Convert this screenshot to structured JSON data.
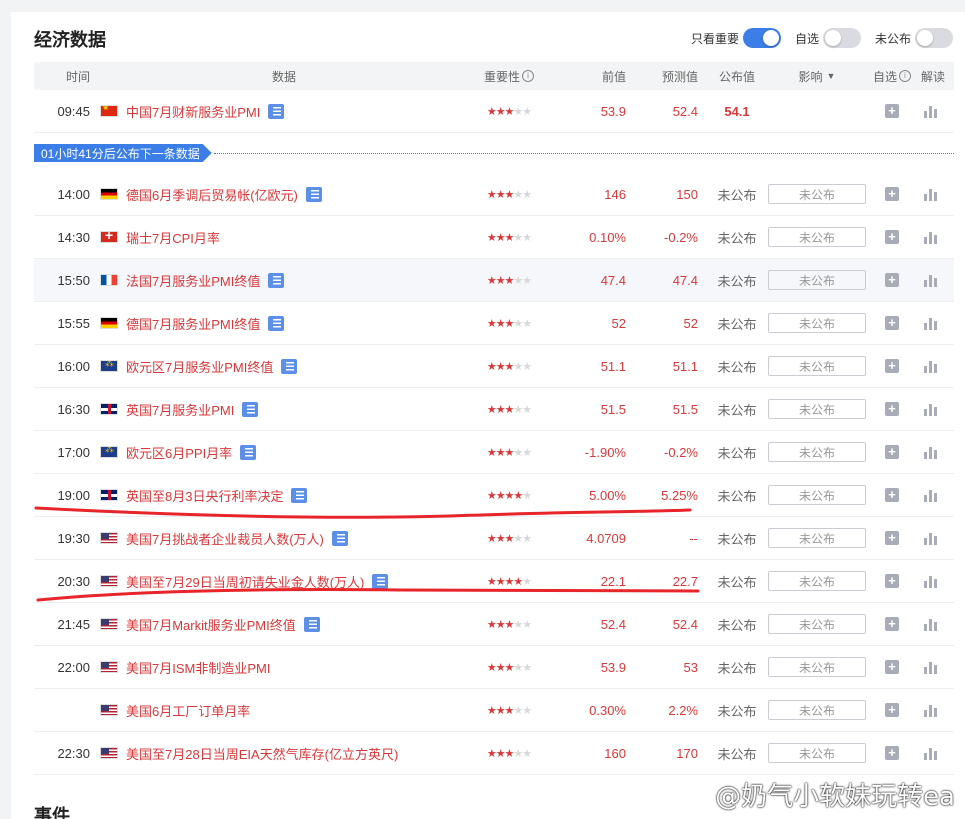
{
  "header": {
    "title": "经济数据",
    "toggles": [
      {
        "label": "只看重要",
        "on": true
      },
      {
        "label": "自选",
        "on": false
      },
      {
        "label": "未公布",
        "on": false
      }
    ]
  },
  "table": {
    "columns": {
      "time": "时间",
      "data": "数据",
      "importance": "重要性",
      "previous": "前值",
      "forecast": "预测值",
      "actual": "公布值",
      "impact": "影响",
      "watch": "自选",
      "analysis": "解读"
    },
    "rows": [
      {
        "time": "09:45",
        "flag": "cn",
        "name": "中国7月财新服务业PMI",
        "doc": true,
        "stars": 3,
        "prev": "53.9",
        "fore": "52.4",
        "actual": "54.1",
        "impact": "",
        "hl": false
      },
      {
        "time": "14:00",
        "flag": "de",
        "name": "德国6月季调后贸易帐(亿欧元)",
        "doc": true,
        "stars": 3,
        "prev": "146",
        "fore": "150",
        "actual": "未公布",
        "impact": "未公布",
        "hl": false
      },
      {
        "time": "14:30",
        "flag": "ch",
        "name": "瑞士7月CPI月率",
        "doc": false,
        "stars": 3,
        "prev": "0.10%",
        "fore": "-0.2%",
        "actual": "未公布",
        "impact": "未公布",
        "hl": false
      },
      {
        "time": "15:50",
        "flag": "fr",
        "name": "法国7月服务业PMI终值",
        "doc": true,
        "stars": 3,
        "prev": "47.4",
        "fore": "47.4",
        "actual": "未公布",
        "impact": "未公布",
        "hl": true
      },
      {
        "time": "15:55",
        "flag": "de",
        "name": "德国7月服务业PMI终值",
        "doc": true,
        "stars": 3,
        "prev": "52",
        "fore": "52",
        "actual": "未公布",
        "impact": "未公布",
        "hl": false
      },
      {
        "time": "16:00",
        "flag": "eu",
        "name": "欧元区7月服务业PMI终值",
        "doc": true,
        "stars": 3,
        "prev": "51.1",
        "fore": "51.1",
        "actual": "未公布",
        "impact": "未公布",
        "hl": false
      },
      {
        "time": "16:30",
        "flag": "gb",
        "name": "英国7月服务业PMI",
        "doc": true,
        "stars": 3,
        "prev": "51.5",
        "fore": "51.5",
        "actual": "未公布",
        "impact": "未公布",
        "hl": false
      },
      {
        "time": "17:00",
        "flag": "eu",
        "name": "欧元区6月PPI月率",
        "doc": true,
        "stars": 3,
        "prev": "-1.90%",
        "fore": "-0.2%",
        "actual": "未公布",
        "impact": "未公布",
        "hl": false
      },
      {
        "time": "19:00",
        "flag": "gb",
        "name": "英国至8月3日央行利率决定",
        "doc": true,
        "stars": 4,
        "prev": "5.00%",
        "fore": "5.25%",
        "actual": "未公布",
        "impact": "未公布",
        "hl": false
      },
      {
        "time": "19:30",
        "flag": "us",
        "name": "美国7月挑战者企业裁员人数(万人)",
        "doc": true,
        "stars": 3,
        "prev": "4.0709",
        "fore": "--",
        "actual": "未公布",
        "impact": "未公布",
        "hl": false
      },
      {
        "time": "20:30",
        "flag": "us",
        "name": "美国至7月29日当周初请失业金人数(万人)",
        "doc": true,
        "stars": 4,
        "prev": "22.1",
        "fore": "22.7",
        "actual": "未公布",
        "impact": "未公布",
        "hl": false
      },
      {
        "time": "21:45",
        "flag": "us",
        "name": "美国7月Markit服务业PMI终值",
        "doc": true,
        "stars": 3,
        "prev": "52.4",
        "fore": "52.4",
        "actual": "未公布",
        "impact": "未公布",
        "hl": false
      },
      {
        "time": "22:00",
        "flag": "us",
        "name": "美国7月ISM非制造业PMI",
        "doc": false,
        "stars": 3,
        "prev": "53.9",
        "fore": "53",
        "actual": "未公布",
        "impact": "未公布",
        "hl": false
      },
      {
        "time": "",
        "flag": "us",
        "name": "美国6月工厂订单月率",
        "doc": false,
        "stars": 3,
        "prev": "0.30%",
        "fore": "2.2%",
        "actual": "未公布",
        "impact": "未公布",
        "hl": false
      },
      {
        "time": "22:30",
        "flag": "us",
        "name": "美国至7月28日当周EIA天然气库存(亿立方英尺)",
        "doc": false,
        "stars": 3,
        "prev": "160",
        "fore": "170",
        "actual": "未公布",
        "impact": "未公布",
        "hl": false
      }
    ]
  },
  "notice": "01小时41分后公布下一条数据",
  "events_title": "事件",
  "watermark": "@奶气小软妹玩转ea",
  "colors": {
    "accent": "#3c7ee8",
    "value_red": "#d9383a",
    "annotation_red": "#e8252b"
  }
}
